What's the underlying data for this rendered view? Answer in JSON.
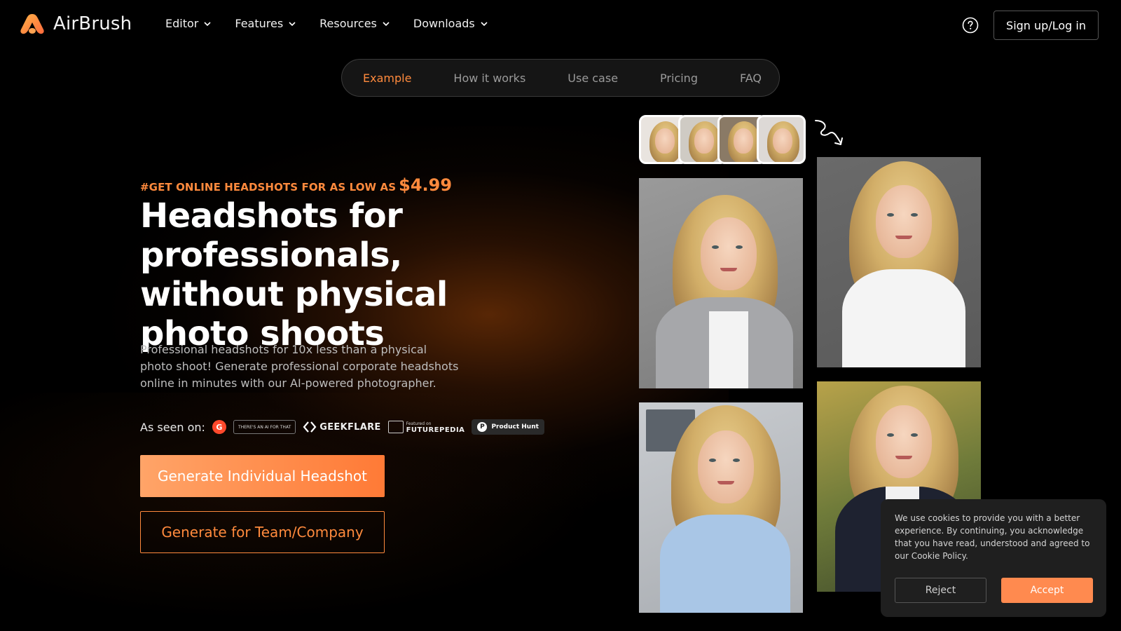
{
  "header": {
    "brand": "AirBrush",
    "logo_icon": "airbrush-logo-icon",
    "nav": [
      {
        "label": "Editor"
      },
      {
        "label": "Features"
      },
      {
        "label": "Resources"
      },
      {
        "label": "Downloads"
      }
    ],
    "help_icon": "help-circle-icon",
    "login_label": "Sign up/Log in"
  },
  "subnav": {
    "items": [
      {
        "label": "Example",
        "active": true
      },
      {
        "label": "How it works"
      },
      {
        "label": "Use case"
      },
      {
        "label": "Pricing"
      },
      {
        "label": "FAQ"
      }
    ]
  },
  "hero": {
    "promo_text": "#GET ONLINE HEADSHOTS FOR AS LOW AS",
    "promo_price": "$4.99",
    "headline": "Headshots for professionals, without physical photo shoots",
    "description": "Professional headshots for 10x less than a physical photo shoot! Generate professional corporate headshots online in minutes with our AI-powered photographer.",
    "seen_on_label": "As seen on:",
    "seen_on": {
      "g2": "G",
      "aitool": "THERE'S AN AI FOR THAT",
      "geekflare": "GEEKFLARE",
      "futurepedia_small": "Featured on",
      "futurepedia": "FUTUREPEDIA",
      "producthunt": "Product Hunt",
      "producthunt_icon": "P"
    },
    "primary_cta": "Generate Individual Headshot",
    "secondary_cta": "Generate for Team/Company"
  },
  "gallery": {
    "arrow_icon": "curly-arrow-down-icon"
  },
  "cookie": {
    "text": "We use cookies to provide you with a better experience. By continuing, you acknowledge that you have read, understood and agreed to our Cookie Policy.",
    "reject_label": "Reject",
    "accept_label": "Accept"
  },
  "colors": {
    "accent": "#ff8a3d",
    "background": "#000000"
  }
}
